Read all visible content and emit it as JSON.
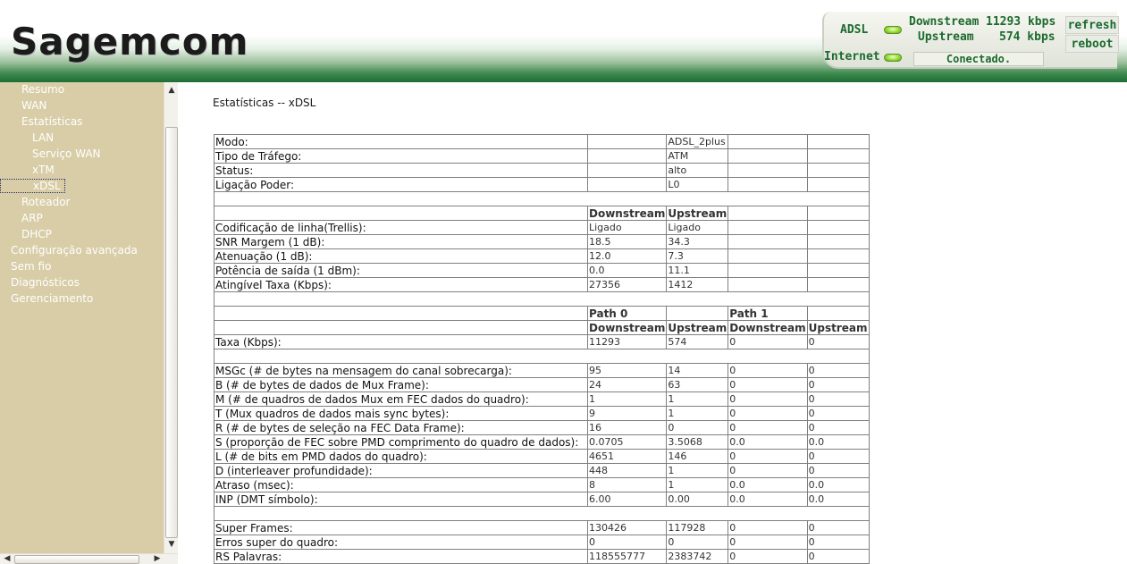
{
  "header": {
    "logo_text": "Sagemcom",
    "adsl_label": "ADSL",
    "internet_label": "Internet",
    "downstream_label": "Downstream",
    "downstream_value": "11293 kbps",
    "upstream_label": "Upstream",
    "upstream_value": "574 kbps",
    "connection_status": "Conectado.",
    "refresh_label": "refresh",
    "reboot_label": "reboot",
    "led_color": "#8fd62a",
    "accent": "#1b6a2e"
  },
  "sidebar": {
    "items": [
      {
        "label": "Resumo",
        "level": 1
      },
      {
        "label": "WAN",
        "level": 1
      },
      {
        "label": "Estatísticas",
        "level": 1
      },
      {
        "label": "LAN",
        "level": 2
      },
      {
        "label": "Serviço WAN",
        "level": 2
      },
      {
        "label": "xTM",
        "level": 2
      },
      {
        "label": "xDSL",
        "level": 2,
        "selected": true
      },
      {
        "label": "Roteador",
        "level": 1
      },
      {
        "label": "ARP",
        "level": 1
      },
      {
        "label": "DHCP",
        "level": 1
      },
      {
        "label": "Configuração avançada",
        "level": 0
      },
      {
        "label": "Sem fio",
        "level": 0
      },
      {
        "label": "Diagnósticos",
        "level": 0
      },
      {
        "label": "Gerenciamento",
        "level": 0
      }
    ]
  },
  "main": {
    "title": "Estatísticas -- xDSL",
    "table": {
      "rows": [
        [
          "Modo:",
          "",
          "ADSL_2plus",
          "",
          ""
        ],
        [
          "Tipo de Tráfego:",
          "",
          "ATM",
          "",
          ""
        ],
        [
          "Status:",
          "",
          "alto",
          "",
          ""
        ],
        [
          "Ligação Poder:",
          "",
          "L0",
          "",
          ""
        ],
        [],
        [
          "",
          "Downstream",
          "Upstream",
          "",
          ""
        ],
        [
          "Codificação de linha(Trellis):",
          "Ligado",
          "Ligado",
          "",
          ""
        ],
        [
          "SNR Margem (1 dB):",
          "18.5",
          "34.3",
          "",
          ""
        ],
        [
          "Atenuação (1 dB):",
          "12.0",
          "7.3",
          "",
          ""
        ],
        [
          "Potência de saída (1 dBm):",
          "0.0",
          "11.1",
          "",
          ""
        ],
        [
          "Atingível Taxa (Kbps):",
          "27356",
          "1412",
          "",
          ""
        ],
        [],
        [
          "",
          "Path 0",
          "",
          "Path 1",
          ""
        ],
        [
          "",
          "Downstream",
          "Upstream",
          "Downstream",
          "Upstream"
        ],
        [
          "Taxa (Kbps):",
          "11293",
          "574",
          "0",
          "0"
        ],
        [],
        [
          "MSGc (# de bytes na mensagem do canal sobrecarga):",
          "95",
          "14",
          "0",
          "0"
        ],
        [
          "B (# de bytes de dados de Mux Frame):",
          "24",
          "63",
          "0",
          "0"
        ],
        [
          "M (# de quadros de dados Mux em FEC dados do quadro):",
          "1",
          "1",
          "0",
          "0"
        ],
        [
          "T (Mux quadros de dados mais sync bytes):",
          "9",
          "1",
          "0",
          "0"
        ],
        [
          "R (# de bytes de seleção na FEC Data Frame):",
          "16",
          "0",
          "0",
          "0"
        ],
        [
          "S (proporção de FEC sobre PMD comprimento do quadro de dados):",
          "0.0705",
          "3.5068",
          "0.0",
          "0.0"
        ],
        [
          "L (# de bits em PMD dados do quadro):",
          "4651",
          "146",
          "0",
          "0"
        ],
        [
          "D (interleaver profundidade):",
          "448",
          "1",
          "0",
          "0"
        ],
        [
          "Atraso (msec):",
          "8",
          "1",
          "0.0",
          "0.0"
        ],
        [
          "INP (DMT símbolo):",
          "6.00",
          "0.00",
          "0.0",
          "0.0"
        ],
        [],
        [
          "Super Frames:",
          "130426",
          "117928",
          "0",
          "0"
        ],
        [
          "Erros super do quadro:",
          "0",
          "0",
          "0",
          "0"
        ],
        [
          "RS Palavras:",
          "118555777",
          "2383742",
          "0",
          "0"
        ]
      ]
    }
  }
}
